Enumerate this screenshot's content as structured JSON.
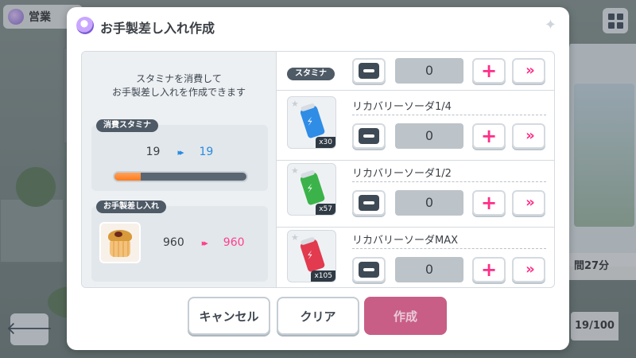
{
  "background": {
    "screen_label": "営業",
    "right_time": "間27分",
    "right_count": "19/100"
  },
  "dialog": {
    "title": "お手製差し入れ作成",
    "description_line1": "スタミナを消費して",
    "description_line2": "お手製差し入れを作成できます",
    "stamina_section": {
      "label": "消費スタミナ",
      "from": "19",
      "to": "19",
      "arrow": "▸▸",
      "bar_fraction": 0.2
    },
    "item_section": {
      "label": "お手製差し入れ",
      "from": "960",
      "to": "960",
      "arrow": "▸▸"
    },
    "stamina_input": {
      "tag": "スタミナ",
      "value": "0"
    },
    "items": [
      {
        "name": "リカバリーソーダ1/4",
        "qty": "x30",
        "value": "0",
        "color": "#2f8de6"
      },
      {
        "name": "リカバリーソーダ1/2",
        "qty": "x57",
        "value": "0",
        "color": "#3bb34a"
      },
      {
        "name": "リカバリーソーダMAX",
        "qty": "x105",
        "value": "0",
        "color": "#e23a4e"
      }
    ],
    "buttons": {
      "cancel": "キャンセル",
      "clear": "クリア",
      "create": "作成"
    }
  },
  "icons": {
    "minus": "minus-icon",
    "plus": "+",
    "max": "»"
  },
  "colors": {
    "accent_pink": "#ff2e86",
    "accent_blue": "#2a8be0",
    "bar_orange": "#ff7b1c",
    "create_disabled": "#c85e86"
  }
}
